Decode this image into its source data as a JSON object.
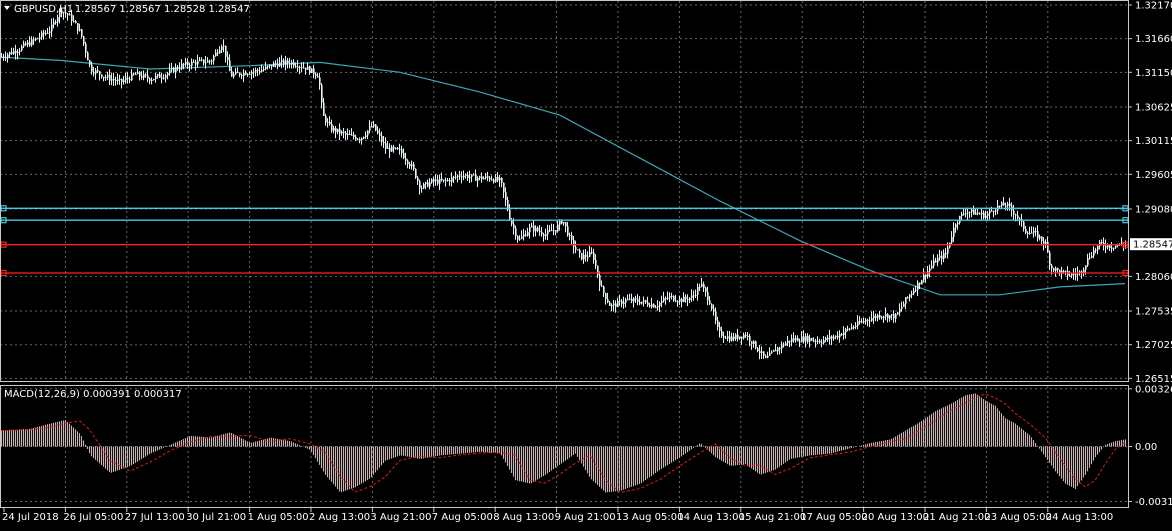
{
  "chart_data": [
    {
      "type": "candlestick",
      "title": "GBPUSD,H1",
      "ohlc_readout": [
        "1.28567",
        "1.28567",
        "1.28528",
        "1.28547"
      ],
      "current_price": "1.28547",
      "price_axis_labels": [
        "1.32170",
        "1.31660",
        "1.31150",
        "1.30625",
        "1.30115",
        "1.29605",
        "1.29080",
        "1.28060",
        "1.27535",
        "1.27025",
        "1.26515"
      ],
      "ylim": [
        1.2646,
        1.3223
      ],
      "x_tick_labels": [
        "24 Jul 2018",
        "26 Jul 05:00",
        "27 Jul 13:00",
        "30 Jul 21:00",
        "1 Aug 05:00",
        "2 Aug 13:00",
        "3 Aug 21:00",
        "7 Aug 05:00",
        "8 Aug 13:00",
        "9 Aug 21:00",
        "13 Aug 05:00",
        "14 Aug 13:00",
        "15 Aug 21:00",
        "17 Aug 05:00",
        "20 Aug 13:00",
        "21 Aug 21:00",
        "23 Aug 05:00",
        "24 Aug 13:00"
      ],
      "price_path": [
        [
          0,
          1.3138
        ],
        [
          18,
          1.315
        ],
        [
          35,
          1.3165
        ],
        [
          50,
          1.318
        ],
        [
          60,
          1.321
        ],
        [
          70,
          1.3198
        ],
        [
          80,
          1.3175
        ],
        [
          90,
          1.312
        ],
        [
          105,
          1.3108
        ],
        [
          120,
          1.31
        ],
        [
          135,
          1.3112
        ],
        [
          150,
          1.3105
        ],
        [
          165,
          1.3112
        ],
        [
          180,
          1.3125
        ],
        [
          195,
          1.313
        ],
        [
          210,
          1.3132
        ],
        [
          222,
          1.316
        ],
        [
          230,
          1.311
        ],
        [
          245,
          1.3115
        ],
        [
          260,
          1.3118
        ],
        [
          275,
          1.3128
        ],
        [
          290,
          1.313
        ],
        [
          305,
          1.3122
        ],
        [
          318,
          1.311
        ],
        [
          322,
          1.305
        ],
        [
          330,
          1.303
        ],
        [
          345,
          1.302
        ],
        [
          360,
          1.3015
        ],
        [
          372,
          1.3035
        ],
        [
          385,
          1.3
        ],
        [
          400,
          1.2995
        ],
        [
          412,
          1.297
        ],
        [
          420,
          1.294
        ],
        [
          432,
          1.295
        ],
        [
          445,
          1.295
        ],
        [
          460,
          1.296
        ],
        [
          475,
          1.2955
        ],
        [
          490,
          1.2955
        ],
        [
          500,
          1.295
        ],
        [
          510,
          1.289
        ],
        [
          518,
          1.286
        ],
        [
          530,
          1.288
        ],
        [
          545,
          1.287
        ],
        [
          555,
          1.2878
        ],
        [
          562,
          1.2892
        ],
        [
          570,
          1.286
        ],
        [
          580,
          1.2835
        ],
        [
          592,
          1.284
        ],
        [
          600,
          1.279
        ],
        [
          610,
          1.276
        ],
        [
          625,
          1.277
        ],
        [
          640,
          1.2768
        ],
        [
          655,
          1.2762
        ],
        [
          668,
          1.2775
        ],
        [
          680,
          1.277
        ],
        [
          692,
          1.2775
        ],
        [
          700,
          1.2795
        ],
        [
          710,
          1.2765
        ],
        [
          718,
          1.272
        ],
        [
          730,
          1.2712
        ],
        [
          745,
          1.2718
        ],
        [
          755,
          1.27
        ],
        [
          765,
          1.268
        ],
        [
          775,
          1.2695
        ],
        [
          790,
          1.271
        ],
        [
          805,
          1.2712
        ],
        [
          820,
          1.2708
        ],
        [
          835,
          1.2715
        ],
        [
          850,
          1.2728
        ],
        [
          865,
          1.274
        ],
        [
          880,
          1.2748
        ],
        [
          895,
          1.2745
        ],
        [
          905,
          1.277
        ],
        [
          915,
          1.279
        ],
        [
          925,
          1.281
        ],
        [
          935,
          1.283
        ],
        [
          945,
          1.284
        ],
        [
          955,
          1.2888
        ],
        [
          965,
          1.2905
        ],
        [
          975,
          1.2902
        ],
        [
          985,
          1.2898
        ],
        [
          995,
          1.291
        ],
        [
          1005,
          1.2915
        ],
        [
          1015,
          1.29
        ],
        [
          1025,
          1.2875
        ],
        [
          1035,
          1.287
        ],
        [
          1045,
          1.2855
        ],
        [
          1050,
          1.282
        ],
        [
          1060,
          1.2812
        ],
        [
          1070,
          1.2808
        ],
        [
          1080,
          1.2812
        ],
        [
          1090,
          1.284
        ],
        [
          1100,
          1.2855
        ],
        [
          1110,
          1.2852
        ],
        [
          1125,
          1.28547
        ]
      ],
      "moving_average": [
        [
          0,
          1.3138
        ],
        [
          60,
          1.3133
        ],
        [
          150,
          1.312
        ],
        [
          250,
          1.3125
        ],
        [
          320,
          1.313
        ],
        [
          400,
          1.3115
        ],
        [
          480,
          1.3085
        ],
        [
          560,
          1.305
        ],
        [
          640,
          1.2985
        ],
        [
          720,
          1.292
        ],
        [
          800,
          1.286
        ],
        [
          870,
          1.2815
        ],
        [
          940,
          1.2778
        ],
        [
          1000,
          1.2778
        ],
        [
          1060,
          1.279
        ],
        [
          1125,
          1.2795
        ]
      ],
      "horizontal_lines": [
        {
          "price": 1.2909,
          "color": "#48c8e6"
        },
        {
          "price": 1.2891,
          "color": "#48c8e6"
        },
        {
          "price": 1.2854,
          "color": "#ff2020"
        },
        {
          "price": 1.2811,
          "color": "#ff2020"
        }
      ],
      "colors": {
        "candle": "#e6f3f7",
        "ma": "#3aa9b8",
        "grid": "#a0a0a0",
        "price_tag_bg": "#ffffff",
        "price_tag_text": "#000000"
      }
    },
    {
      "type": "histogram",
      "title": "MACD(12,26,9) 0.000391 0.000317",
      "axis_labels": [
        "0.003262",
        "0.00",
        "-0.003108"
      ],
      "ylim": [
        -0.00342,
        0.00342
      ],
      "macd_path": [
        [
          0,
          0.0009
        ],
        [
          30,
          0.001
        ],
        [
          50,
          0.0013
        ],
        [
          65,
          0.0015
        ],
        [
          80,
          0.0007
        ],
        [
          90,
          -0.0005
        ],
        [
          110,
          -0.0015
        ],
        [
          130,
          -0.0011
        ],
        [
          150,
          -0.0004
        ],
        [
          170,
          0.0001
        ],
        [
          190,
          0.0006
        ],
        [
          210,
          0.0005
        ],
        [
          230,
          0.0008
        ],
        [
          250,
          0.0002
        ],
        [
          270,
          0.0005
        ],
        [
          290,
          0.0003
        ],
        [
          310,
          -0.0002
        ],
        [
          325,
          -0.0016
        ],
        [
          340,
          -0.0026
        ],
        [
          355,
          -0.0023
        ],
        [
          370,
          -0.0018
        ],
        [
          385,
          -0.0008
        ],
        [
          400,
          -0.0005
        ],
        [
          420,
          -0.0007
        ],
        [
          440,
          -0.0005
        ],
        [
          460,
          -0.0004
        ],
        [
          480,
          -0.0003
        ],
        [
          500,
          -0.0004
        ],
        [
          515,
          -0.0019
        ],
        [
          530,
          -0.0021
        ],
        [
          545,
          -0.0016
        ],
        [
          560,
          -0.001
        ],
        [
          575,
          -0.0004
        ],
        [
          590,
          -0.0018
        ],
        [
          605,
          -0.0026
        ],
        [
          620,
          -0.0025
        ],
        [
          640,
          -0.0021
        ],
        [
          660,
          -0.0013
        ],
        [
          680,
          -0.0006
        ],
        [
          700,
          0.0002
        ],
        [
          715,
          -0.0006
        ],
        [
          730,
          -0.0011
        ],
        [
          745,
          -0.001
        ],
        [
          760,
          -0.0016
        ],
        [
          775,
          -0.0013
        ],
        [
          790,
          -0.0007
        ],
        [
          810,
          -0.0005
        ],
        [
          830,
          -0.0004
        ],
        [
          850,
          -0.0001
        ],
        [
          870,
          0.0002
        ],
        [
          890,
          0.0004
        ],
        [
          905,
          0.0009
        ],
        [
          920,
          0.0014
        ],
        [
          935,
          0.002
        ],
        [
          950,
          0.0024
        ],
        [
          965,
          0.0029
        ],
        [
          975,
          0.003
        ],
        [
          985,
          0.0026
        ],
        [
          995,
          0.0023
        ],
        [
          1005,
          0.0016
        ],
        [
          1015,
          0.0013
        ],
        [
          1030,
          0.0006
        ],
        [
          1045,
          -0.0006
        ],
        [
          1055,
          -0.0014
        ],
        [
          1065,
          -0.0021
        ],
        [
          1075,
          -0.0024
        ],
        [
          1085,
          -0.0016
        ],
        [
          1095,
          -0.0006
        ],
        [
          1105,
          0.0001
        ],
        [
          1115,
          0.0003
        ],
        [
          1125,
          0.0004
        ]
      ],
      "colors": {
        "bars": "#c8b4b4",
        "signal": "#e01a1a"
      }
    }
  ]
}
